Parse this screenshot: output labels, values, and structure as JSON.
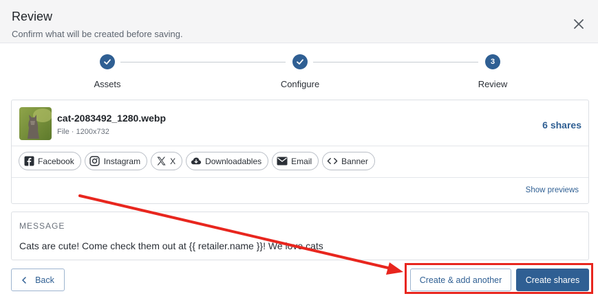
{
  "header": {
    "title": "Review",
    "subtitle": "Confirm what will be created before saving."
  },
  "stepper": {
    "steps": [
      {
        "label": "Assets",
        "state": "complete"
      },
      {
        "label": "Configure",
        "state": "complete"
      },
      {
        "label": "Review",
        "state": "current",
        "number": "3"
      }
    ]
  },
  "asset": {
    "file_name": "cat-2083492_1280.webp",
    "file_meta": "File · 1200x732",
    "shares_label": "6 shares",
    "channels": [
      {
        "label": "Facebook",
        "icon": "facebook-icon"
      },
      {
        "label": "Instagram",
        "icon": "instagram-icon"
      },
      {
        "label": "X",
        "icon": "x-icon"
      },
      {
        "label": "Downloadables",
        "icon": "cloud-download-icon"
      },
      {
        "label": "Email",
        "icon": "envelope-icon"
      },
      {
        "label": "Banner",
        "icon": "code-icon"
      }
    ],
    "show_previews_label": "Show previews"
  },
  "message": {
    "label": "MESSAGE",
    "text": "Cats are cute! Come check them out at {{ retailer.name }}! We love cats"
  },
  "footer": {
    "back_label": "Back",
    "create_add_label": "Create & add another",
    "create_label": "Create shares"
  },
  "colors": {
    "accent": "#2f5f93",
    "annotation": "#e8261e"
  }
}
